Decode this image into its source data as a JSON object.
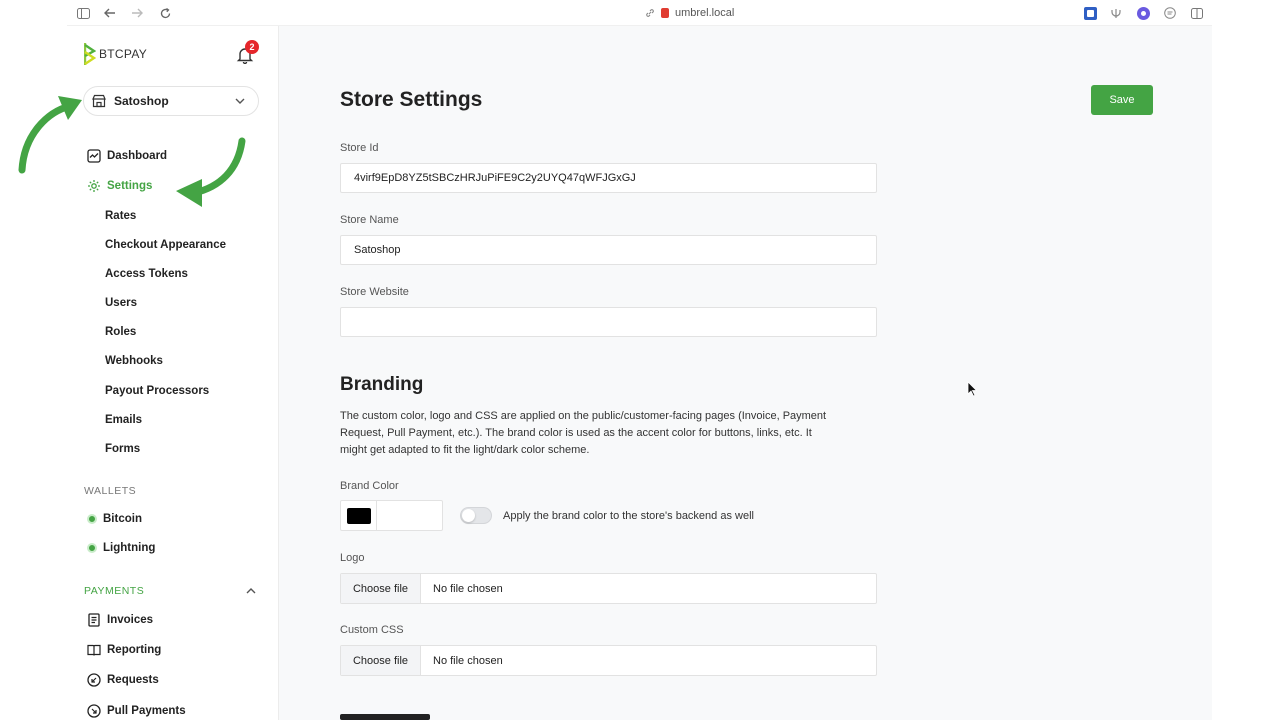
{
  "browser": {
    "url": "umbrel.local"
  },
  "sidebar": {
    "logo_text": "BTCPAY",
    "notification_count": "2",
    "store_name": "Satoshop",
    "nav": {
      "dashboard": "Dashboard",
      "settings": "Settings"
    },
    "settings_items": [
      "Rates",
      "Checkout Appearance",
      "Access Tokens",
      "Users",
      "Roles",
      "Webhooks",
      "Payout Processors",
      "Emails",
      "Forms"
    ],
    "wallets_label": "WALLETS",
    "wallets": [
      "Bitcoin",
      "Lightning"
    ],
    "payments_label": "PAYMENTS",
    "payments": [
      "Invoices",
      "Reporting",
      "Requests",
      "Pull Payments"
    ]
  },
  "main": {
    "title": "Store Settings",
    "save_label": "Save",
    "store_id_label": "Store Id",
    "store_id_value": "4virf9EpD8YZ5tSBCzHRJuPiFE9C2y2UYQ47qWFJGxGJ",
    "store_name_label": "Store Name",
    "store_name_value": "Satoshop",
    "store_website_label": "Store Website",
    "store_website_value": "",
    "branding_heading": "Branding",
    "branding_description": "The custom color, logo and CSS are applied on the public/customer-facing pages (Invoice, Payment Request, Pull Payment, etc.). The brand color is used as the accent color for buttons, links, etc. It might get adapted to fit the light/dark color scheme.",
    "brand_color_label": "Brand Color",
    "brand_color_value": "#000000",
    "brand_toggle_label": "Apply the brand color to the store's backend as well",
    "brand_toggle_on": false,
    "logo_label": "Logo",
    "custom_css_label": "Custom CSS",
    "choose_file_label": "Choose file",
    "no_file_label": "No file chosen"
  },
  "colors": {
    "accent": "#44a444",
    "badge": "#e5262b",
    "annotation_arrow": "#44a444"
  }
}
